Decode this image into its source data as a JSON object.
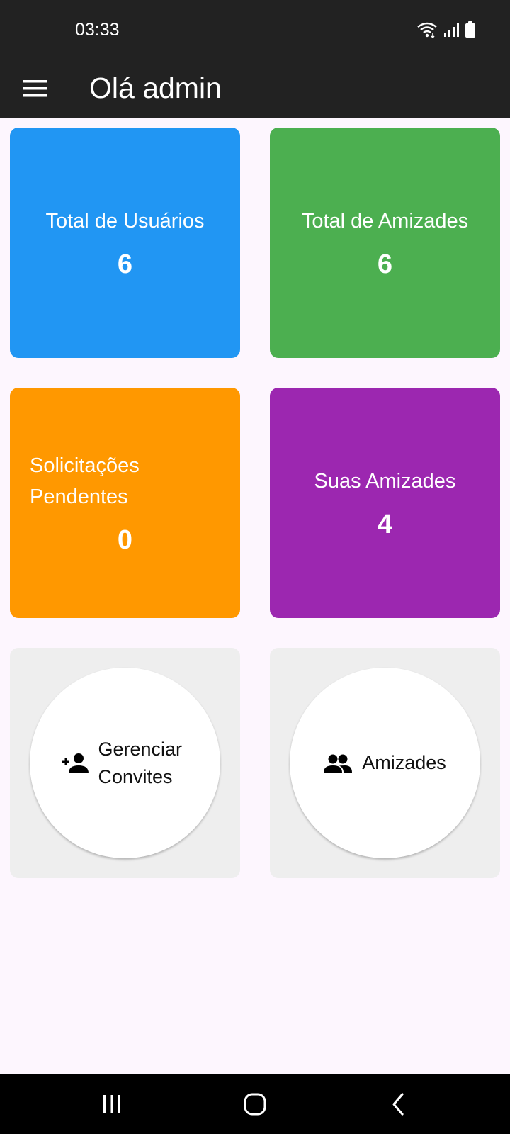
{
  "status_bar": {
    "time": "03:33"
  },
  "app_bar": {
    "title": "Olá admin"
  },
  "stats": [
    {
      "label": "Total de Usuários",
      "value": "6",
      "color": "#2196f3"
    },
    {
      "label": "Total de Amizades",
      "value": "6",
      "color": "#4caf50"
    },
    {
      "label": "Solicitações Pendentes",
      "value": "0",
      "color": "#ff9800"
    },
    {
      "label": "Suas Amizades",
      "value": "4",
      "color": "#9c27b0"
    }
  ],
  "actions": [
    {
      "label": "Gerenciar Convites",
      "icon": "person-add-icon"
    },
    {
      "label": "Amizades",
      "icon": "group-icon"
    }
  ],
  "nav": {
    "icons": [
      "recent-apps-icon",
      "home-icon",
      "back-icon"
    ]
  }
}
